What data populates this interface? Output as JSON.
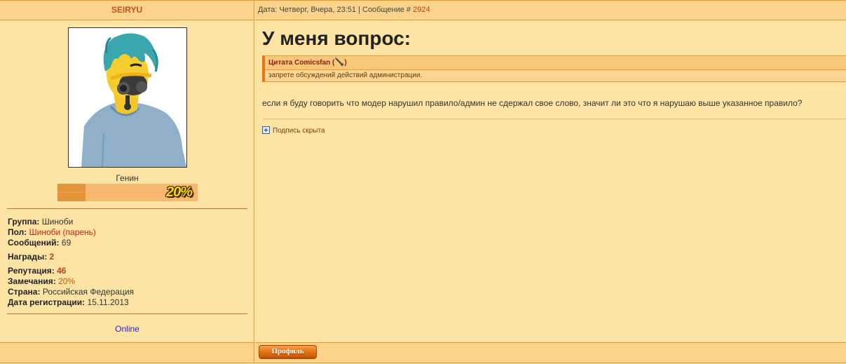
{
  "post": {
    "author": "SEIRYU",
    "meta_prefix": "Дата: Четверг, Вчера, 23:51 | Сообщение # ",
    "post_number": "2924",
    "title": "У меня вопрос:",
    "quote_header": "Цитата Comicsfan (",
    "quote_header_end": ")",
    "quote_text": "запрете обсуждений действий администрации.",
    "message": "если я буду говорить что модер нарушил правило/админ не сдержал свое слово, значит ли это что я нарушаю выше указанное правило?",
    "signature_toggle": "Подпись скрыта"
  },
  "user": {
    "rank": "Генин",
    "rank_progress_label": "20%",
    "rank_progress": 0.2,
    "group_label": "Группа:",
    "group_value": "Шиноби",
    "gender_label": "Пол:",
    "gender_value": "Шиноби (парень)",
    "posts_label": "Сообщений:",
    "posts_value": "69",
    "awards_label": "Награды:",
    "awards_value": "2",
    "reputation_label": "Репутация:",
    "reputation_value": "46",
    "warnings_label": "Замечания:",
    "warnings_value": "20%",
    "country_label": "Страна:",
    "country_value": "Российская Федерация",
    "registered_label": "Дата регистрации:",
    "registered_value": "15.11.2013",
    "status": "Online"
  },
  "footer": {
    "profile_button": "Профиль"
  },
  "colors": {
    "background": "#fde3a4",
    "header": "#fbd38a",
    "border": "#e89a2c",
    "accent_red": "#c8231a",
    "button": "#e46f0e"
  }
}
